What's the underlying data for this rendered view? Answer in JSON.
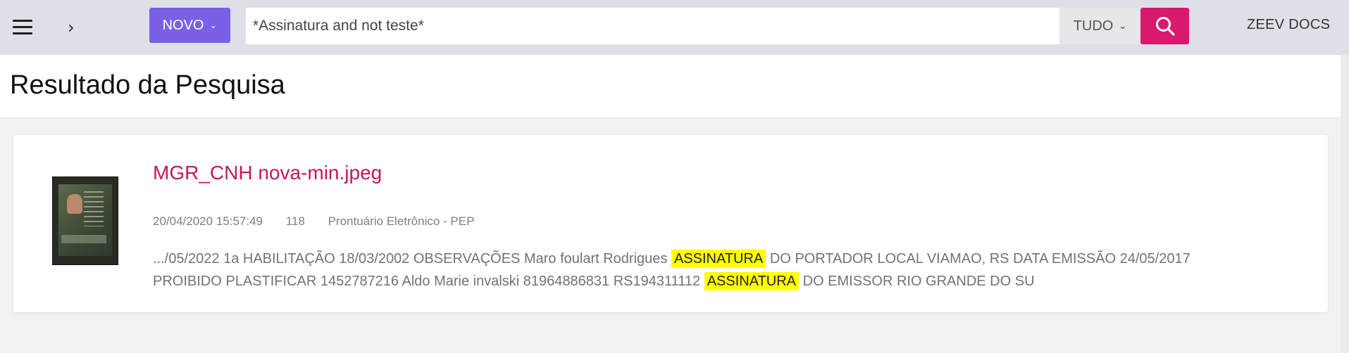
{
  "topbar": {
    "novo_label": "NOVO",
    "search_value": "*Assinatura and not teste*",
    "scope_label": "TUDO",
    "brand": "ZEEV DOCS",
    "accent_color": "#7b5fe6",
    "search_button_color": "#d9196e"
  },
  "icons": {
    "menu": "hamburger-icon",
    "expand": "chevron-right-icon",
    "caret": "chevron-down-icon",
    "search": "search-icon"
  },
  "page": {
    "title": "Resultado da Pesquisa"
  },
  "result": {
    "title": "MGR_CNH nova-min.jpeg",
    "date": "20/04/2020 15:57:49",
    "number": "118",
    "category": "Prontuário Eletrônico - PEP",
    "snippet": {
      "part1": ".../05/2022 1a HABILITAÇÃO 18/03/2002 OBSERVAÇÕES Maro foulart Rodrigues ",
      "highlight1": "ASSINATURA",
      "part2": " DO PORTADOR LOCAL VIAMAO, RS DATA EMISSÃO 24/05/2017 PROIBIDO PLASTIFICAR 1452787216 Aldo Marie invalski 81964886831 RS194311112 ",
      "highlight2": "ASSINATURA",
      "part3": " DO EMISSOR RIO GRANDE DO SU"
    },
    "highlight_color": "#ffff00"
  }
}
